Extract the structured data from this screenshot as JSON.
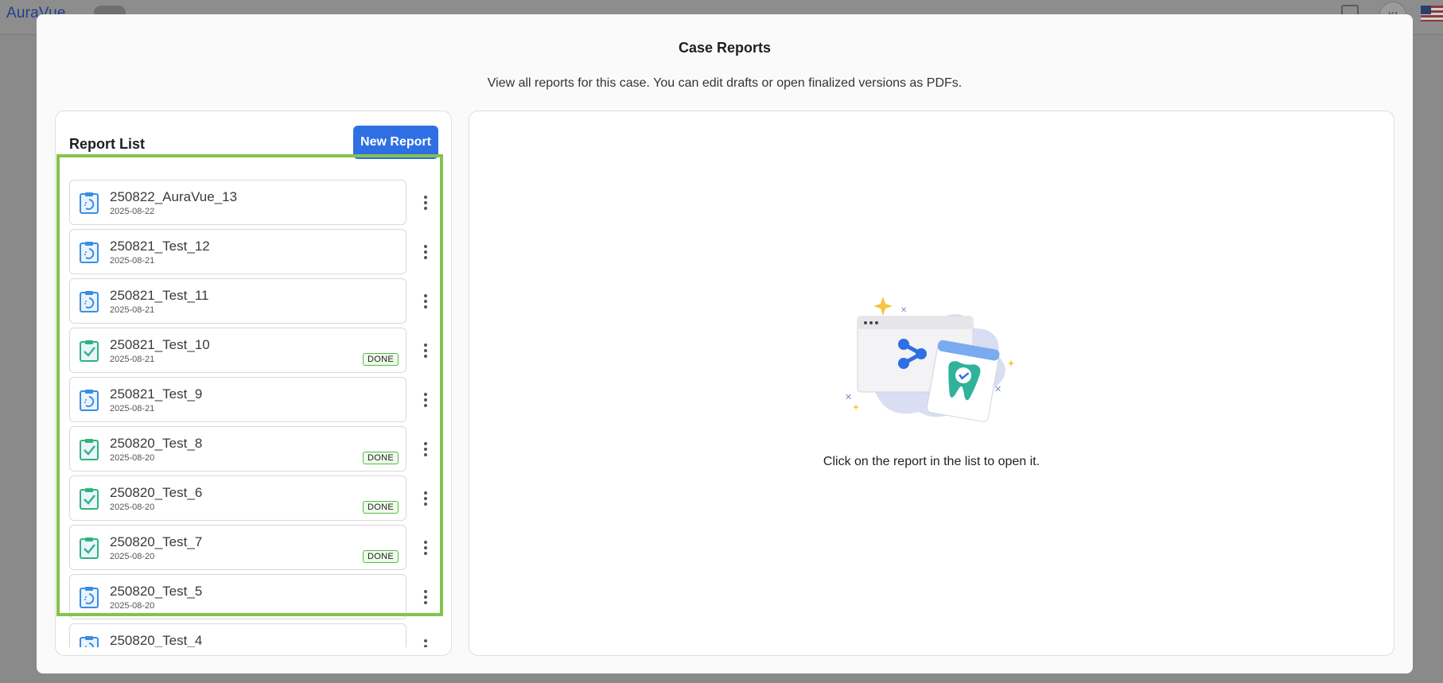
{
  "background": {
    "logo": "AuraVue",
    "avatar_initials": "KI"
  },
  "modal": {
    "title": "Case Reports",
    "subtitle": "View all reports for this case. You can edit drafts or open finalized versions as PDFs."
  },
  "report_list": {
    "header": "Report List",
    "new_button": "New Report",
    "done_label": "DONE",
    "items": [
      {
        "name": "250822_AuraVue_13",
        "date": "2025-08-22",
        "status": "draft"
      },
      {
        "name": "250821_Test_12",
        "date": "2025-08-21",
        "status": "draft"
      },
      {
        "name": "250821_Test_11",
        "date": "2025-08-21",
        "status": "draft"
      },
      {
        "name": "250821_Test_10",
        "date": "2025-08-21",
        "status": "done"
      },
      {
        "name": "250821_Test_9",
        "date": "2025-08-21",
        "status": "draft"
      },
      {
        "name": "250820_Test_8",
        "date": "2025-08-20",
        "status": "done"
      },
      {
        "name": "250820_Test_6",
        "date": "2025-08-20",
        "status": "done"
      },
      {
        "name": "250820_Test_7",
        "date": "2025-08-20",
        "status": "done"
      },
      {
        "name": "250820_Test_5",
        "date": "2025-08-20",
        "status": "draft"
      },
      {
        "name": "250820_Test_4",
        "date": "",
        "status": "draft"
      }
    ]
  },
  "viewer": {
    "empty_message": "Click on the report in the list to open it."
  },
  "colors": {
    "accent": "#2f6fe4",
    "highlight": "#85c34a",
    "draft_icon": "#3b8de0",
    "done_icon": "#2fb37b"
  }
}
